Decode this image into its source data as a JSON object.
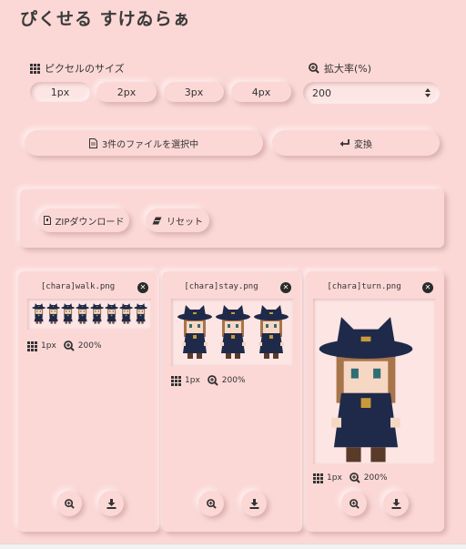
{
  "app": {
    "title": "ぴくせる すけゐらぁ"
  },
  "pixel_size": {
    "label": "ピクセルのサイズ",
    "options": [
      "1px",
      "2px",
      "3px",
      "4px"
    ],
    "selected": "1px"
  },
  "zoom": {
    "label": "拡大率(%)",
    "value": "200"
  },
  "file_button": {
    "label": "3件のファイルを選択中"
  },
  "convert_button": {
    "label": "変換"
  },
  "actions": {
    "zip_label": "ZIPダウンロード",
    "reset_label": "リセット"
  },
  "cards": [
    {
      "filename": "[chara]walk.png",
      "pixel": "1px",
      "zoom": "200%",
      "sprites": 8
    },
    {
      "filename": "[chara]stay.png",
      "pixel": "1px",
      "zoom": "200%",
      "sprites": 3
    },
    {
      "filename": "[chara]turn.png",
      "pixel": "1px",
      "zoom": "200%",
      "sprites": 1
    }
  ],
  "colors": {
    "background": "#fbd8d6",
    "hat": "#1f2a4a",
    "hair": "#a8744a",
    "skin": "#f6d7c3",
    "dress": "#1f2a4a"
  }
}
